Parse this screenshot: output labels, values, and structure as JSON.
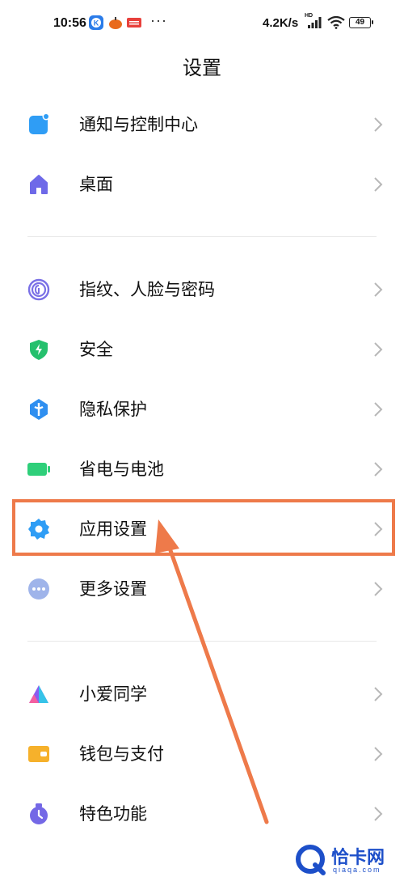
{
  "status_bar": {
    "time": "10:56",
    "dots": "···",
    "network_speed": "4.2K/s",
    "hd_label": "HD",
    "battery": "49",
    "icons": [
      "k-app-icon",
      "pumpkin-icon",
      "toutiao-icon",
      "signal-icon",
      "wifi-icon",
      "battery-icon"
    ]
  },
  "header": {
    "title": "设置"
  },
  "settings": {
    "items": [
      {
        "label": "通知与控制中心",
        "icon": "notification-icon",
        "color": "#2f9df5"
      },
      {
        "label": "桌面",
        "icon": "home-icon",
        "color": "#6e69e8"
      },
      {
        "label": "指纹、人脸与密码",
        "icon": "fingerprint-icon",
        "color": "#7a70e6"
      },
      {
        "label": "安全",
        "icon": "shield-icon",
        "color": "#25c06d"
      },
      {
        "label": "隐私保护",
        "icon": "privacy-icon",
        "color": "#2f8ff0"
      },
      {
        "label": "省电与电池",
        "icon": "battery-icon",
        "color": "#2fcf7a"
      },
      {
        "label": "应用设置",
        "icon": "gear-icon",
        "color": "#2f9df5"
      },
      {
        "label": "更多设置",
        "icon": "more-icon",
        "color": "#9fb4ea"
      },
      {
        "label": "小爱同学",
        "icon": "xiaoai-icon",
        "color": "#8a5cf0"
      },
      {
        "label": "钱包与支付",
        "icon": "wallet-icon",
        "color": "#f6b12b"
      },
      {
        "label": "特色功能",
        "icon": "feature-icon",
        "color": "#7468e6"
      }
    ]
  },
  "annotation": {
    "highlight_color": "#ee7a4a"
  },
  "watermark": {
    "text": "恰卡网",
    "sub": "qiaqa.com",
    "color": "#1d4fc9"
  }
}
